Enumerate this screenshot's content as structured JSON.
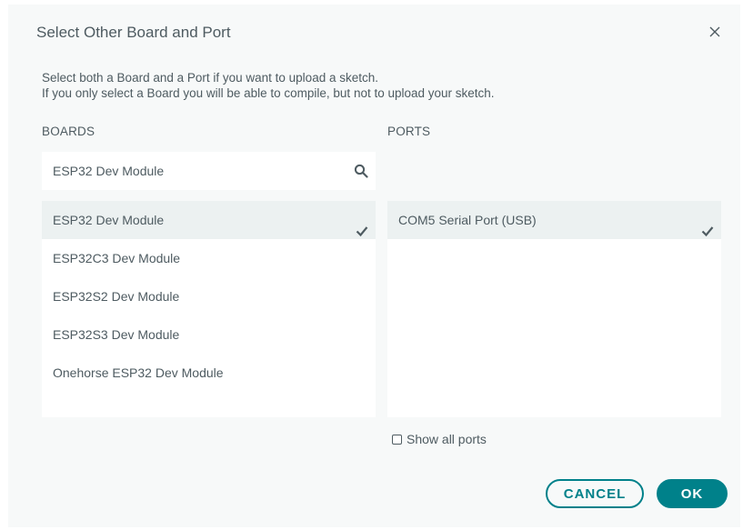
{
  "dialog": {
    "title": "Select Other Board and Port",
    "description_line1": "Select both a Board and a Port if you want to upload a sketch.",
    "description_line2": "If you only select a Board you will be able to compile, but not to upload your sketch."
  },
  "boards": {
    "label": "BOARDS",
    "search_value": "ESP32 Dev Module",
    "items": [
      {
        "label": "ESP32 Dev Module",
        "selected": true
      },
      {
        "label": "ESP32C3 Dev Module",
        "selected": false
      },
      {
        "label": "ESP32S2 Dev Module",
        "selected": false
      },
      {
        "label": "ESP32S3 Dev Module",
        "selected": false
      },
      {
        "label": "Onehorse ESP32 Dev Module",
        "selected": false
      }
    ]
  },
  "ports": {
    "label": "PORTS",
    "items": [
      {
        "label": "COM5 Serial Port (USB)",
        "selected": true
      }
    ],
    "show_all_label": "Show all ports",
    "show_all_checked": false
  },
  "buttons": {
    "cancel": "CANCEL",
    "ok": "OK"
  },
  "icons": {
    "close": "close-icon",
    "search": "search-icon",
    "check": "checkmark-icon"
  },
  "colors": {
    "accent": "#00818a",
    "text": "#4e5b61",
    "dialog_bg": "#f7f9f9",
    "selected_bg": "#ecf1f1"
  }
}
